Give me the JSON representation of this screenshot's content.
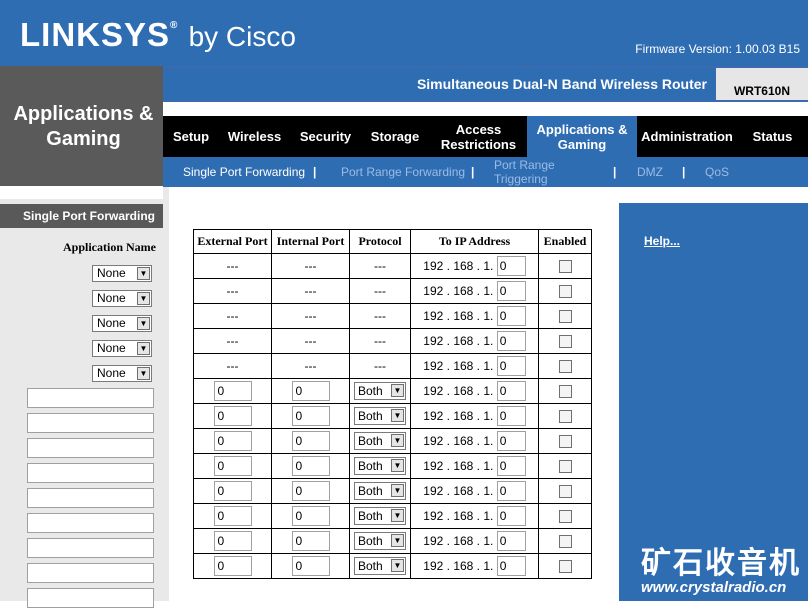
{
  "header": {
    "brand": "LINKSYS",
    "brand_suffix": "by Cisco",
    "firmware": "Firmware Version: 1.00.03 B15",
    "product_name": "Simultaneous Dual-N Band Wireless Router",
    "model": "WRT610N"
  },
  "section_title": "Applications & Gaming",
  "nav": {
    "tabs": [
      {
        "label": "Setup"
      },
      {
        "label": "Wireless"
      },
      {
        "label": "Security"
      },
      {
        "label": "Storage"
      },
      {
        "label": "Access Restrictions"
      },
      {
        "label": "Applications & Gaming"
      },
      {
        "label": "Administration"
      },
      {
        "label": "Status"
      }
    ],
    "active": "Applications & Gaming"
  },
  "subnav": {
    "items": [
      {
        "label": "Single Port Forwarding"
      },
      {
        "label": "Port Range Forwarding"
      },
      {
        "label": "Port Range Triggering"
      },
      {
        "label": "DMZ"
      },
      {
        "label": "QoS"
      }
    ],
    "separator": "|",
    "active": "Single Port Forwarding"
  },
  "left": {
    "heading": "Single Port Forwarding",
    "app_name_header": "Application Name",
    "app_dropdowns": [
      "None",
      "None",
      "None",
      "None",
      "None"
    ],
    "app_text_inputs": [
      "",
      "",
      "",
      "",
      "",
      "",
      "",
      "",
      ""
    ],
    "dropdown_arrow": "▼"
  },
  "table": {
    "headers": [
      "External Port",
      "Internal Port",
      "Protocol",
      "To IP Address",
      "Enabled"
    ],
    "ip_prefix": "192 . 168 . 1.",
    "fixed_rows": [
      {
        "external": "---",
        "internal": "---",
        "protocol": "---",
        "ip_last": "0"
      },
      {
        "external": "---",
        "internal": "---",
        "protocol": "---",
        "ip_last": "0"
      },
      {
        "external": "---",
        "internal": "---",
        "protocol": "---",
        "ip_last": "0"
      },
      {
        "external": "---",
        "internal": "---",
        "protocol": "---",
        "ip_last": "0"
      },
      {
        "external": "---",
        "internal": "---",
        "protocol": "---",
        "ip_last": "0"
      }
    ],
    "custom_rows": [
      {
        "external": "0",
        "internal": "0",
        "protocol": "Both",
        "ip_last": "0"
      },
      {
        "external": "0",
        "internal": "0",
        "protocol": "Both",
        "ip_last": "0"
      },
      {
        "external": "0",
        "internal": "0",
        "protocol": "Both",
        "ip_last": "0"
      },
      {
        "external": "0",
        "internal": "0",
        "protocol": "Both",
        "ip_last": "0"
      },
      {
        "external": "0",
        "internal": "0",
        "protocol": "Both",
        "ip_last": "0"
      },
      {
        "external": "0",
        "internal": "0",
        "protocol": "Both",
        "ip_last": "0"
      },
      {
        "external": "0",
        "internal": "0",
        "protocol": "Both",
        "ip_last": "0"
      },
      {
        "external": "0",
        "internal": "0",
        "protocol": "Both",
        "ip_last": "0"
      }
    ]
  },
  "right": {
    "help": "Help..."
  },
  "watermark": {
    "cn": "矿石收音机",
    "url": "www.crystalradio.cn"
  },
  "colors": {
    "brand_blue": "#2f6db3",
    "dark_gray": "#5a5a5a",
    "nav_black": "#000000"
  }
}
